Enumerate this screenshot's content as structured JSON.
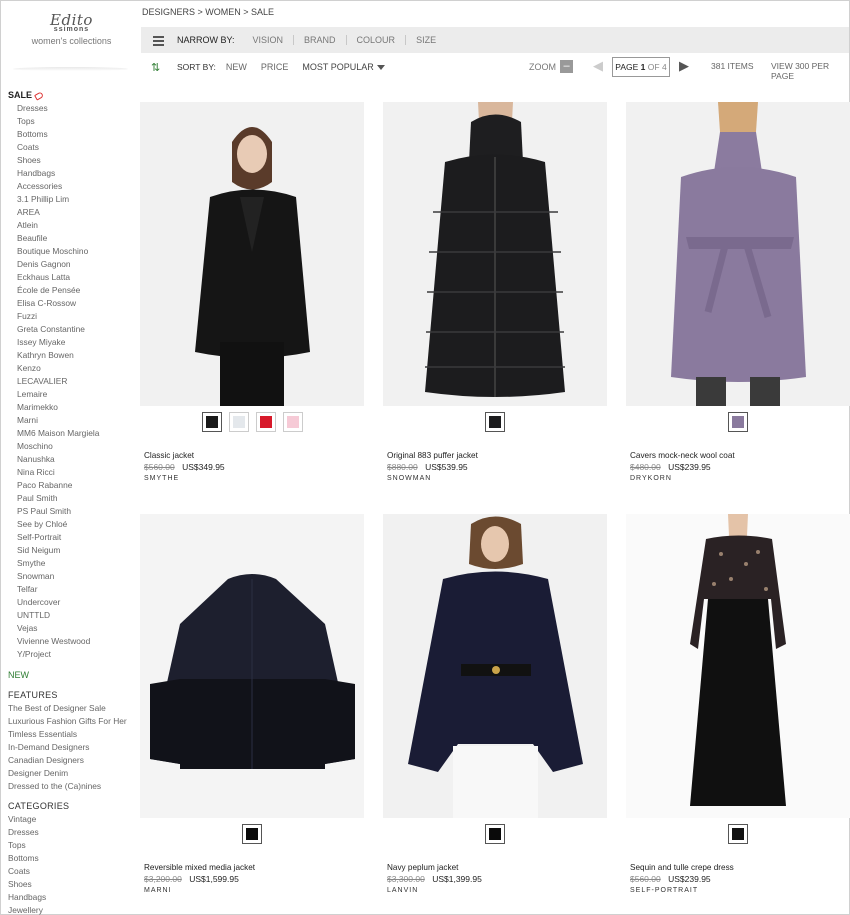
{
  "logo": {
    "script": "Edito",
    "brand": "ssimons",
    "subtitle": "women's collections"
  },
  "sidebar": {
    "sale_label": "SALE",
    "sale_items": [
      "Dresses",
      "Tops",
      "Bottoms",
      "Coats",
      "Shoes",
      "Handbags",
      "Accessories",
      "3.1 Phillip Lim",
      "AREA",
      "Atlein",
      "Beaufile",
      "Boutique Moschino",
      "Denis Gagnon",
      "Eckhaus Latta",
      "École de Pensée",
      "Elisa C-Rossow",
      "Fuzzi",
      "Greta Constantine",
      "Issey Miyake",
      "Kathryn Bowen",
      "Kenzo",
      "LECAVALIER",
      "Lemaire",
      "Marimekko",
      "Marni",
      "MM6 Maison Margiela",
      "Moschino",
      "Nanushka",
      "Nina Ricci",
      "Paco Rabanne",
      "Paul Smith",
      "PS Paul Smith",
      "See by Chloé",
      "Self-Portrait",
      "Sid Neigum",
      "Smythe",
      "Snowman",
      "Telfar",
      "Undercover",
      "UNTTLD",
      "Vejas",
      "Vivienne Westwood",
      "Y/Project"
    ],
    "new_label": "NEW",
    "features_label": "FEATURES",
    "features_items": [
      "The Best of Designer Sale",
      "Luxurious Fashion Gifts For Her",
      "Timless Essentials",
      "In-Demand Designers",
      "Canadian Designers",
      "Designer Denim",
      "Dressed to the (Ca)nines"
    ],
    "categories_label": "CATEGORIES",
    "categories_items": [
      "Vintage",
      "Dresses",
      "Tops",
      "Bottoms",
      "Coats",
      "Shoes",
      "Handbags",
      "Jewellery"
    ]
  },
  "breadcrumb": "DESIGNERS > WOMEN > SALE",
  "filter": {
    "label": "NARROW BY:",
    "options": [
      "VISION",
      "BRAND",
      "COLOUR",
      "SIZE"
    ]
  },
  "sort": {
    "label": "SORT BY:",
    "options": [
      "NEW",
      "PRICE"
    ],
    "selected": "MOST POPULAR"
  },
  "pager": {
    "zoom_label": "ZOOM",
    "zoom_button": "–",
    "page_word": "PAGE",
    "page_num": "1",
    "of_text": "OF 4",
    "items": "381 ITEMS",
    "view_per": "VIEW 300 PER PAGE"
  },
  "products": [
    {
      "name": "Classic jacket",
      "orig": "$560.00",
      "sale": "US$349.95",
      "brand": "SMYTHE",
      "swatches": [
        "#1a1a1a",
        "#e4e8ec",
        "#d7192a",
        "#f6cad6"
      ]
    },
    {
      "name": "Original 883 puffer jacket",
      "orig": "$880.00",
      "sale": "US$539.95",
      "brand": "SNOWMAN",
      "swatches": [
        "#1c1c1e"
      ]
    },
    {
      "name": "Cavers mock-neck wool coat",
      "orig": "$480.00",
      "sale": "US$239.95",
      "brand": "DRYKORN",
      "swatches": [
        "#8a7a9e"
      ]
    },
    {
      "name": "Reversible mixed media jacket",
      "orig": "$3,200.00",
      "sale": "US$1,599.95",
      "brand": "MARNI",
      "swatches": [
        "#0a0a0a"
      ]
    },
    {
      "name": "Navy peplum jacket",
      "orig": "$3,300.00",
      "sale": "US$1,399.95",
      "brand": "LANVIN",
      "swatches": [
        "#0a0a0a"
      ]
    },
    {
      "name": "Sequin and tulle crepe dress",
      "orig": "$560.00",
      "sale": "US$239.95",
      "brand": "SELF-PORTRAIT",
      "swatches": [
        "#111111"
      ]
    }
  ],
  "colors": {
    "accent_green": "#2e7d32",
    "sale_red": "#d33333"
  }
}
